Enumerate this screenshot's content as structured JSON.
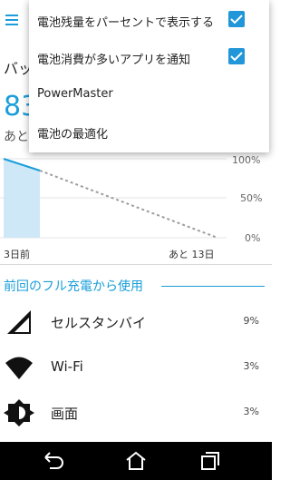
{
  "header": {
    "title_partial": "バッ"
  },
  "battery": {
    "percent_partial": "83",
    "remaining_prefix": "あと"
  },
  "usage_graph": {
    "y_labels": [
      "100%",
      "50%",
      "0%"
    ],
    "x_left": "3日前",
    "x_right": "あと 13日"
  },
  "section": {
    "title": "前回のフル充電から使用"
  },
  "usage_items": [
    {
      "name": "セルスタンバイ",
      "percent": "9%",
      "icon": "cell-signal-icon"
    },
    {
      "name": "Wi-Fi",
      "percent": "3%",
      "icon": "wifi-icon"
    },
    {
      "name": "画面",
      "percent": "3%",
      "icon": "brightness-icon"
    }
  ],
  "menu": {
    "items": [
      {
        "label": "電池残量をパーセントで表示する",
        "checked": true
      },
      {
        "label": "電池消費が多いアプリを通知",
        "checked": true
      },
      {
        "label": "PowerMaster"
      },
      {
        "label": "電池の最適化"
      }
    ]
  },
  "navbar": {
    "icons": [
      "back-icon",
      "home-icon",
      "recents-icon"
    ]
  },
  "colors": {
    "accent": "#1a9ed9",
    "checkbox": "#2196d8",
    "navbar": "#000000"
  }
}
